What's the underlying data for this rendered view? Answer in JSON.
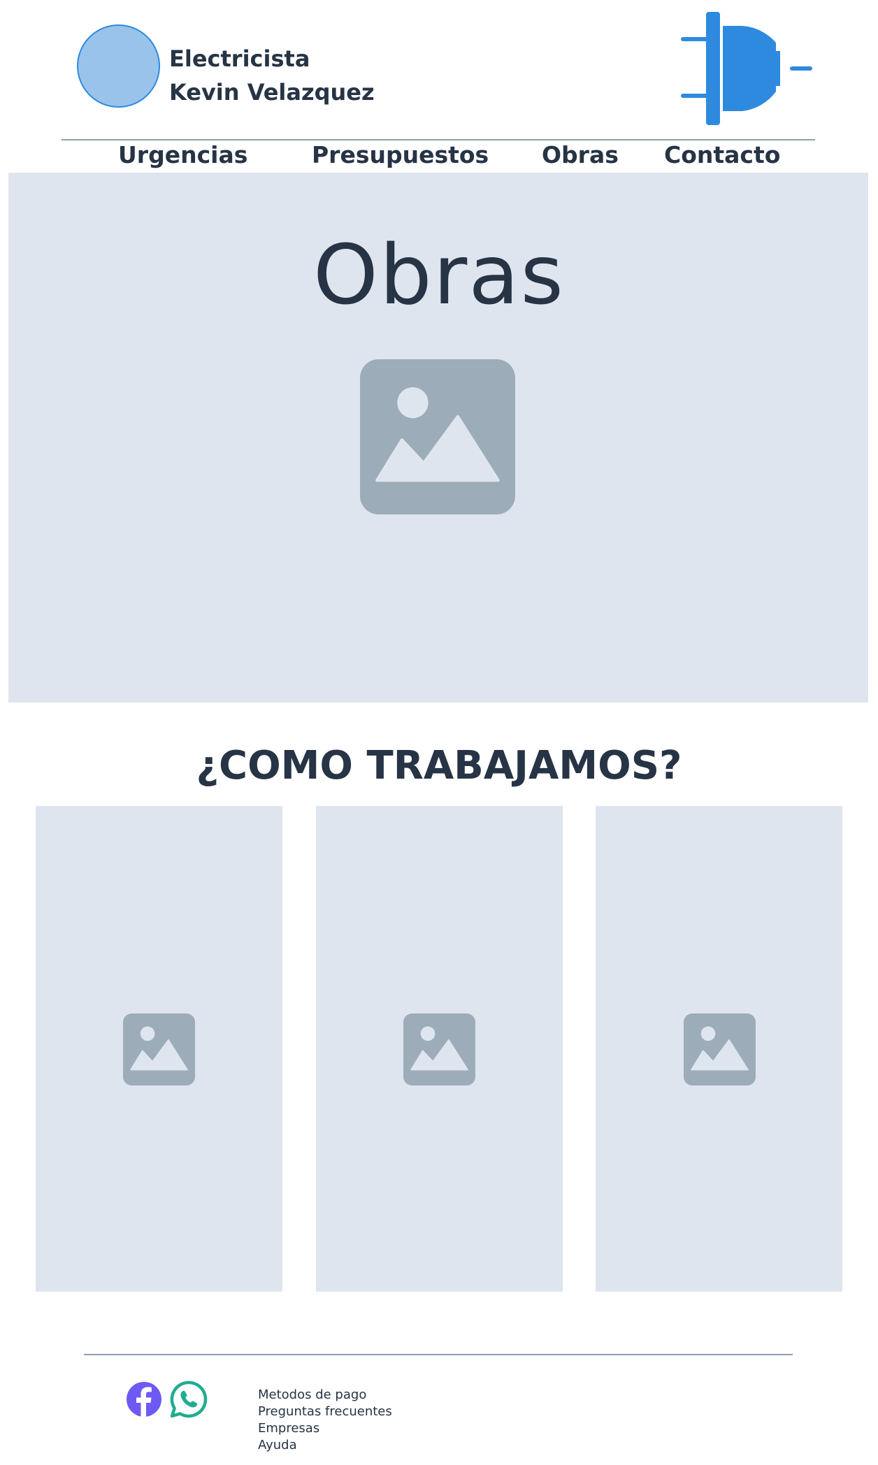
{
  "header": {
    "brand_line1": "Electricista",
    "brand_line2": "Kevin Velazquez",
    "logo_icon": "avatar-circle",
    "plug_icon": "electric-plug-icon"
  },
  "nav": {
    "items": [
      {
        "label": "Urgencias"
      },
      {
        "label": "Presupuestos"
      },
      {
        "label": "Obras"
      },
      {
        "label": "Contacto"
      }
    ]
  },
  "hero": {
    "title": "Obras",
    "image_icon": "image-placeholder-icon"
  },
  "how_we_work": {
    "title": "¿COMO TRABAJAMOS?",
    "cards": [
      {
        "image_icon": "image-placeholder-icon"
      },
      {
        "image_icon": "image-placeholder-icon"
      },
      {
        "image_icon": "image-placeholder-icon"
      }
    ]
  },
  "footer": {
    "social": [
      {
        "icon": "facebook-icon"
      },
      {
        "icon": "whatsapp-icon"
      }
    ],
    "links": [
      "Metodos de pago",
      "Preguntas frecuentes",
      "Empresas",
      "Ayuda"
    ]
  },
  "colors": {
    "text": "#263445",
    "accent_blue": "#2e8ade",
    "logo_fill": "#9ac3ec",
    "panel_bg": "#dfe5ee",
    "placeholder": "#9dacb9",
    "rule": "#8ea0b2",
    "facebook": "#6e5af2",
    "whatsapp": "#1fad8f"
  }
}
